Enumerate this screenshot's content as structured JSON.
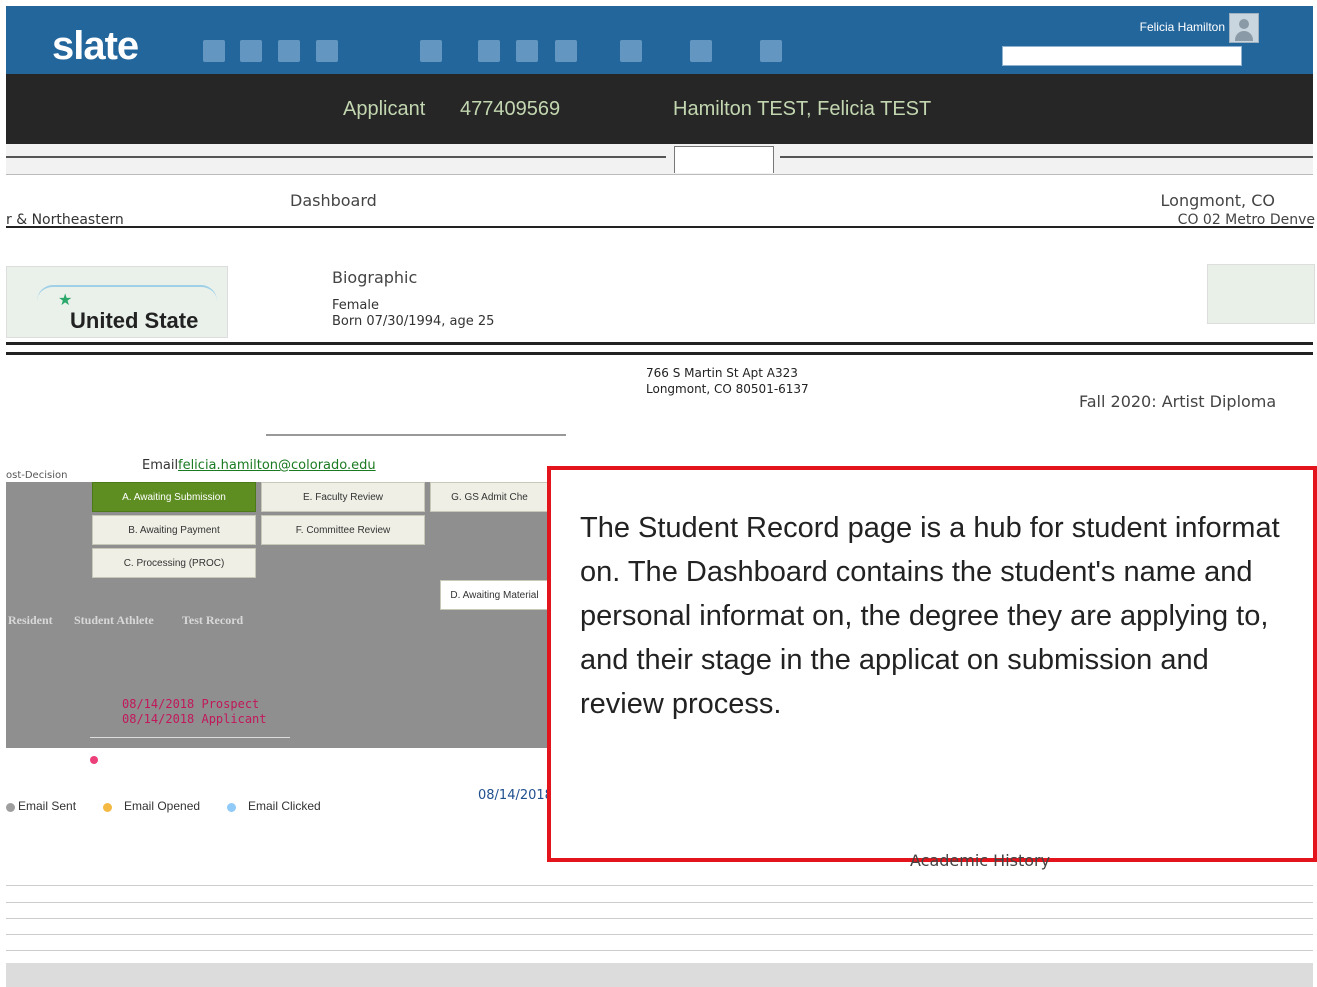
{
  "header": {
    "logo": "slate",
    "user_name": "Felicia Hamilton"
  },
  "applicant_banner": {
    "label": "Applicant",
    "id": "477409569",
    "name": "Hamilton TEST, Felicia TEST"
  },
  "dashboard": {
    "title": "Dashboard",
    "location": "Longmont, CO",
    "location_sub": "CO 02 Metro Denve",
    "region_cut": "r & Northeastern",
    "map_label": "United State",
    "biographic": {
      "title": "Biographic",
      "gender": "Female",
      "born": "Born 07/30/1994, age 25"
    },
    "address": {
      "line1": "766 S Martin St Apt A323",
      "line2": "Longmont, CO 80501-6137"
    },
    "program": "Fall 2020: Artist Diploma",
    "email_label": "Email",
    "email": "felicia.hamilton@colorado.edu",
    "post_decision": "ost-Decision"
  },
  "workflow": {
    "bins": [
      {
        "label": "A. Awaiting Submission",
        "active": true
      },
      {
        "label": "B. Awaiting Payment",
        "active": false
      },
      {
        "label": "C. Processing (PROC)",
        "active": false
      },
      {
        "label": "E. Faculty Review",
        "active": false
      },
      {
        "label": "F. Committee Review",
        "active": false
      },
      {
        "label": "G. GS Admit Che",
        "active": false
      },
      {
        "label": "D. Awaiting Material",
        "active": false
      }
    ],
    "flags": [
      "Resident",
      "Student Athlete",
      "Test Record"
    ],
    "timeline": [
      "08/14/2018 Prospect",
      "08/14/2018 Applicant"
    ],
    "timeline_date": "08/14/2018"
  },
  "legend": [
    {
      "label": "Email Sent",
      "color": "#9e9e9e"
    },
    {
      "label": "Email Opened",
      "color": "#f4b942"
    },
    {
      "label": "Email Clicked",
      "color": "#90caf9"
    }
  ],
  "callout": {
    "text": "The Student Record page  is a hub for student informat on. The Dashboard contains the student's name and personal informat on, the degree they are applying to, and their stage in the applicat on submission and review process.",
    "border_color": "#e3141b"
  },
  "academic_history": "Academic History"
}
